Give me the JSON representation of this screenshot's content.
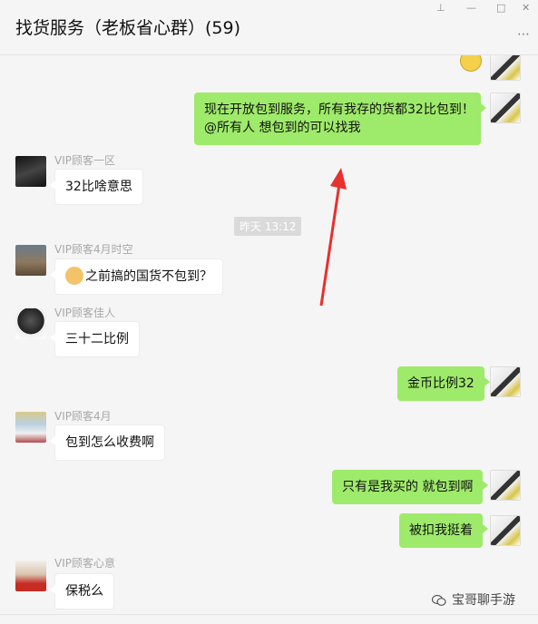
{
  "header": {
    "title": "找货服务（老板省心群）(59)",
    "more_icon": "⋯"
  },
  "window_controls": {
    "pin_icon": "⊥",
    "minimize_icon": "—",
    "maximize_icon": "□",
    "close_icon": "✕"
  },
  "messages": [
    {
      "side": "out",
      "text_lines": [
        "现在开放包到服务，所有我存的货都32比包到！",
        "@所有人  想包到的可以找我"
      ]
    },
    {
      "side": "in",
      "name": "VIP顾客一区",
      "text": "32比啥意思"
    },
    {
      "type": "time",
      "text": "昨天 13:12"
    },
    {
      "side": "in",
      "name": "VIP顾客4月时空",
      "text": "之前搞的国货不包到？"
    },
    {
      "side": "in",
      "name": "VIP顾客佳人",
      "text": "三十二比例"
    },
    {
      "side": "out",
      "text": "金币比例32"
    },
    {
      "side": "in",
      "name": "VIP顾客4月",
      "text": "包到怎么收费啊"
    },
    {
      "side": "out",
      "text": "只有是我买的 就包到啊"
    },
    {
      "side": "out",
      "text": "被扣我挺着"
    },
    {
      "side": "in",
      "name": "VIP顾客心意",
      "text": "保税么"
    }
  ],
  "watermark": {
    "text": "宝哥聊手游"
  },
  "colors": {
    "out_bubble": "#9eea6a",
    "in_bubble": "#ffffff",
    "annotation_arrow": "#e8302c"
  }
}
